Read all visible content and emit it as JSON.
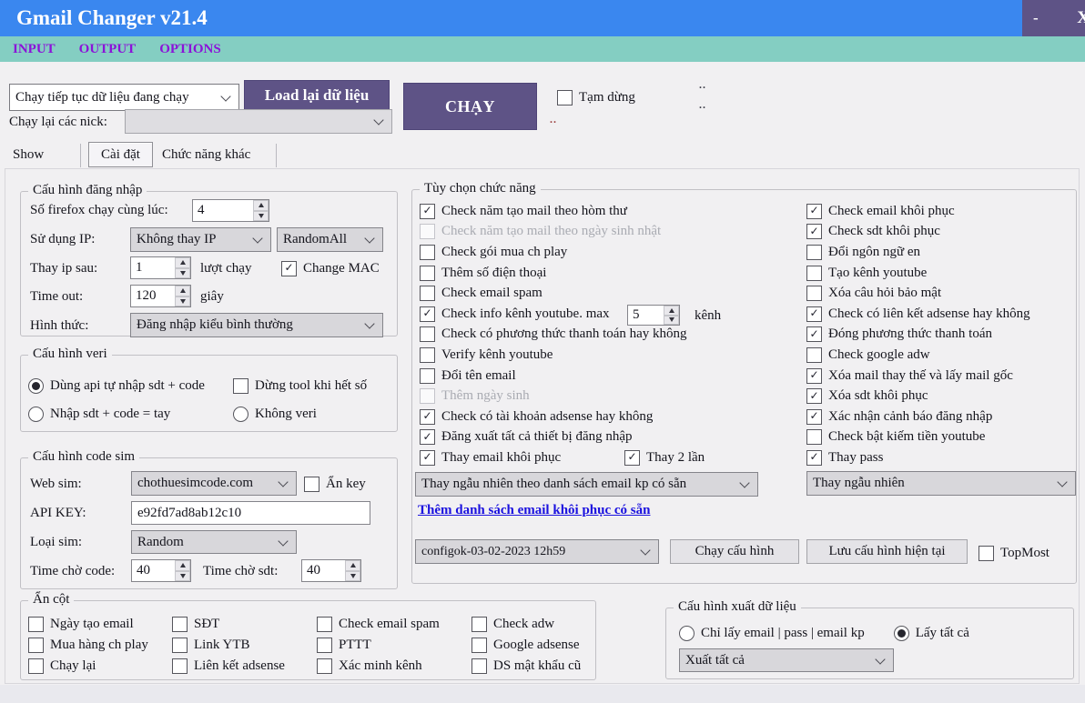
{
  "window": {
    "title": "Gmail Changer v21.4",
    "minimize_label": "-",
    "close_label": "X"
  },
  "menu": {
    "items": [
      "INPUT",
      "OUTPUT",
      "OPTIONS"
    ]
  },
  "toolbar": {
    "resume_dropdown": "Chạy tiếp tục dữ liệu đang chạy",
    "reload_button": "Load lại dữ liệu",
    "rerun_label": "Chạy lại các nick:",
    "rerun_dropdown": "",
    "run_button": "CHẠY",
    "pause": [
      {
        "label": "Tạm dừng",
        "checked": false
      }
    ],
    "marks": {
      "top": "..",
      "middle": "..",
      "red": ".."
    }
  },
  "tabs": {
    "items": [
      "Show",
      "Cài đặt",
      "Chức năng khác"
    ],
    "selected": "Cài đặt"
  },
  "login_group": {
    "title": "Cấu hình đăng nhập",
    "firefox_label": "Số firefox chạy cùng lúc:",
    "firefox_value": "4",
    "ip_label": "Sử dụng IP:",
    "ip_mode": "Không thay IP",
    "ip_random": "RandomAll",
    "change_ip_label": "Thay ip sau:",
    "change_ip_value": "1",
    "change_ip_suffix": "lượt chạy",
    "change_mac": [
      {
        "label": "Change MAC",
        "checked": true
      }
    ],
    "timeout_label": "Time out:",
    "timeout_value": "120",
    "timeout_suffix": "giây",
    "method_label": "Hình thức:",
    "method_value": "Đăng nhập kiểu bình thường"
  },
  "veri_group": {
    "title": "Cấu hình veri",
    "radios_left": [
      {
        "label": "Dùng api tự nhập sdt + code",
        "checked": true
      },
      {
        "label": "Nhập sdt + code = tay",
        "checked": false
      }
    ],
    "stop_checkbox": [
      {
        "label": "Dừng tool khi hết số",
        "checked": false
      }
    ],
    "radios_right": [
      {
        "label": "Không veri",
        "checked": false
      }
    ]
  },
  "sim_group": {
    "title": "Cấu hình code sim",
    "web_label": "Web sim:",
    "web_value": "chothuesimcode.com",
    "hide_key": [
      {
        "label": "Ẩn key",
        "checked": false
      }
    ],
    "api_label": "API KEY:",
    "api_value": "e92fd7ad8ab12c10",
    "type_label": "Loại sim:",
    "type_value": "Random",
    "wait_code_label": "Time chờ code:",
    "wait_code_value": "40",
    "wait_sdt_label": "Time chờ sdt:",
    "wait_sdt_value": "40"
  },
  "hide_columns_group": {
    "title": "Ẩn cột",
    "col1": [
      {
        "label": "Ngày tạo email",
        "checked": false
      },
      {
        "label": "Mua hàng ch play",
        "checked": false
      },
      {
        "label": "Chạy lại",
        "checked": false
      }
    ],
    "col2": [
      {
        "label": "SĐT",
        "checked": false
      },
      {
        "label": "Link YTB",
        "checked": false
      },
      {
        "label": "Liên kết adsense",
        "checked": false
      }
    ],
    "col3": [
      {
        "label": "Check email spam",
        "checked": false
      },
      {
        "label": "PTTT",
        "checked": false
      },
      {
        "label": "Xác minh kênh",
        "checked": false
      }
    ],
    "col4": [
      {
        "label": "Check adw",
        "checked": false
      },
      {
        "label": "Google adsense",
        "checked": false
      },
      {
        "label": "DS mật khẩu cũ",
        "checked": false
      }
    ]
  },
  "options_group": {
    "title": "Tùy chọn chức năng",
    "left": [
      {
        "label": "Check năm tạo mail theo hòm thư",
        "checked": true
      },
      {
        "label": "Check năm tạo mail theo ngày sinh nhật",
        "checked": false,
        "disabled": true
      },
      {
        "label": "Check gói mua ch play",
        "checked": false
      },
      {
        "label": "Thêm số điện thoại",
        "checked": false
      },
      {
        "label": "Check email spam",
        "checked": false
      },
      {
        "label": "Check info kênh youtube. max",
        "checked": true
      },
      {
        "label": "Check có phương thức thanh toán hay không",
        "checked": false
      },
      {
        "label": "Verify kênh youtube",
        "checked": false
      },
      {
        "label": "Đổi tên email",
        "checked": false
      },
      {
        "label": "Thêm ngày sinh",
        "checked": false,
        "disabled": true
      },
      {
        "label": "Check có tài khoản adsense hay không",
        "checked": true
      },
      {
        "label": "Đăng xuất tất cả thiết bị đăng nhập",
        "checked": true
      },
      {
        "label": "Thay email khôi phục",
        "checked": true
      }
    ],
    "thay2lan": [
      {
        "label": "Thay 2 lần",
        "checked": true
      }
    ],
    "max_value": "5",
    "max_suffix": "kênh",
    "right": [
      {
        "label": "Check email khôi phục",
        "checked": true
      },
      {
        "label": "Check sdt khôi phục",
        "checked": true
      },
      {
        "label": "Đổi ngôn ngữ en",
        "checked": false
      },
      {
        "label": "Tạo kênh youtube",
        "checked": false
      },
      {
        "label": "Xóa câu hỏi bảo mật",
        "checked": false
      },
      {
        "label": "Check có liên kết adsense hay không",
        "checked": true
      },
      {
        "label": "Đóng phương thức thanh toán",
        "checked": true
      },
      {
        "label": "Check google adw",
        "checked": false
      },
      {
        "label": "Xóa mail thay thế và lấy mail gốc",
        "checked": true
      },
      {
        "label": "Xóa sdt khôi phục",
        "checked": true
      },
      {
        "label": "Xác nhận cảnh báo đăng nhập",
        "checked": true
      },
      {
        "label": "Check bật kiếm tiền youtube",
        "checked": false
      },
      {
        "label": "Thay pass",
        "checked": true
      }
    ],
    "recovery_dropdown": "Thay ngẫu nhiên theo danh sách email kp có sẵn",
    "recovery_link": "Thêm danh sách email khôi phục có sẵn",
    "pass_dropdown": "Thay ngẫu nhiên",
    "config_dropdown": "configok-03-02-2023 12h59",
    "run_config_button": "Chạy cấu hình",
    "save_config_button": "Lưu cấu hình hiện tại",
    "topmost": [
      {
        "label": "TopMost",
        "checked": false
      }
    ]
  },
  "export_group": {
    "title": "Cấu hình xuất dữ liệu",
    "radios": [
      {
        "label": "Chỉ lấy email | pass | email kp",
        "checked": false
      },
      {
        "label": "Lấy tất cả",
        "checked": true
      }
    ],
    "export_dropdown": "Xuất tất cả"
  },
  "colors": {
    "titlebar": "#3a87ef",
    "menubar": "#84cec2",
    "accent_purple": "#5e5386",
    "menu_text": "#8b12d9",
    "link": "#1b12df"
  }
}
